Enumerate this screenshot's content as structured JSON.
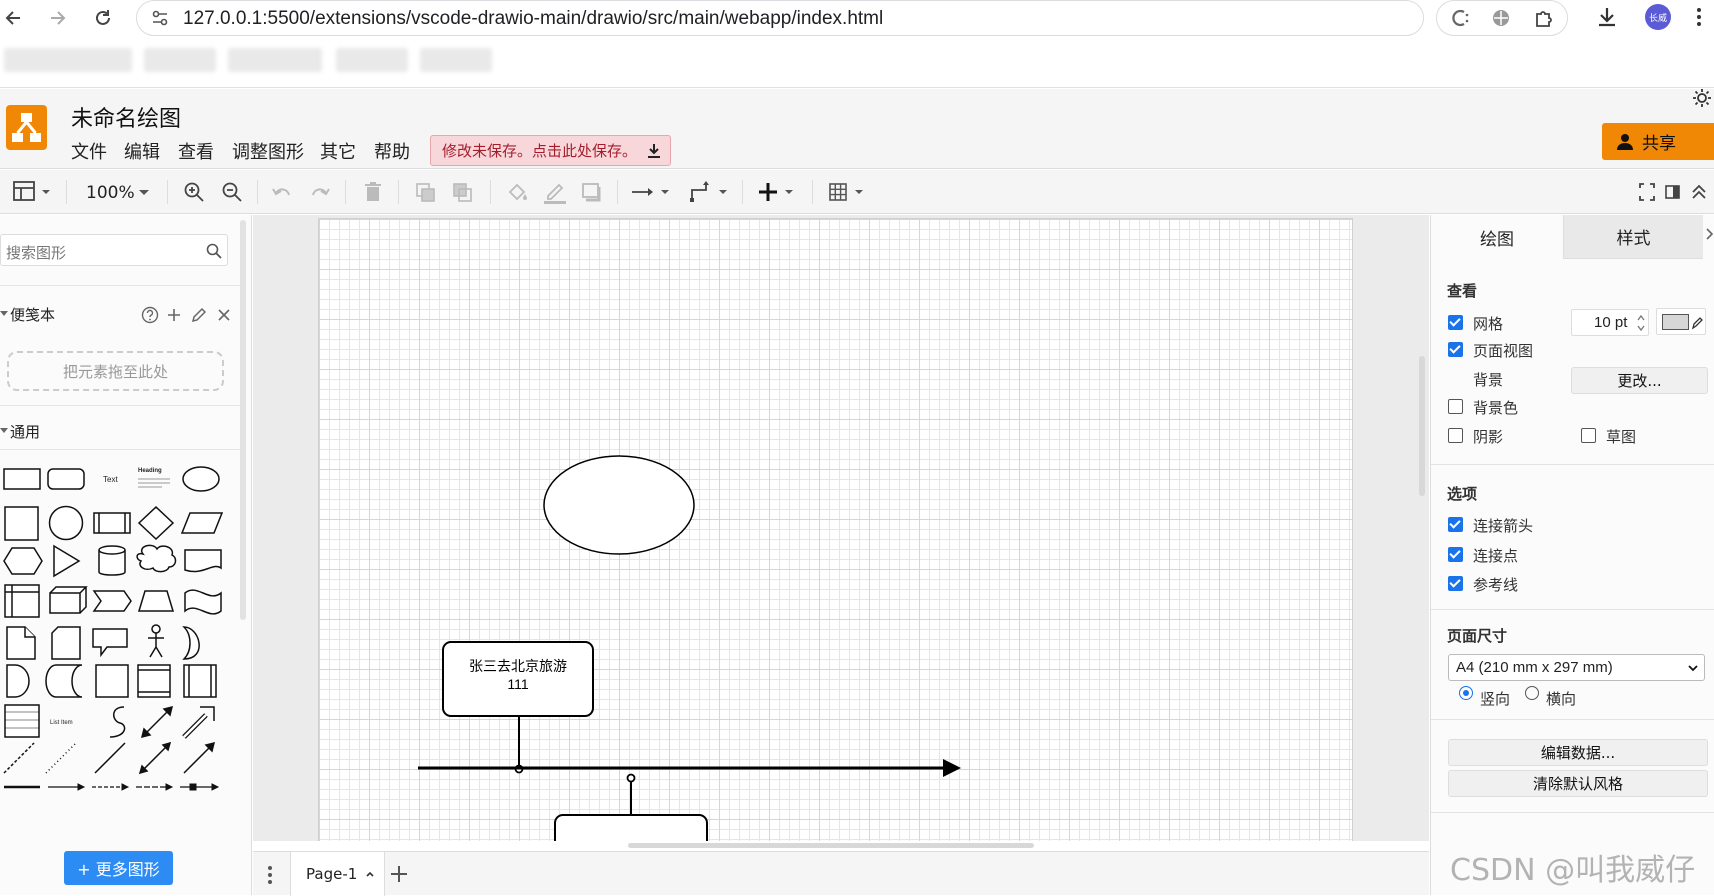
{
  "browser": {
    "url": "127.0.0.1:5500/extensions/vscode-drawio-main/drawio/src/main/webapp/index.html",
    "avatar_label": "长威"
  },
  "app": {
    "title": "未命名绘图",
    "menu": [
      "文件",
      "编辑",
      "查看",
      "调整图形",
      "其它",
      "帮助"
    ],
    "unsaved_notice": "修改未保存。点击此处保存。",
    "share_label": "共享"
  },
  "toolbar": {
    "zoom": "100%"
  },
  "left_panel": {
    "search_placeholder": "搜索图形",
    "scratchpad_title": "便笺本",
    "drop_hint": "把元素拖至此处",
    "general_title": "通用",
    "shape_labels": {
      "text": "Text",
      "heading": "Heading",
      "list_item": "List Item"
    },
    "more_shapes": "+ 更多图形"
  },
  "diagram": {
    "box1_line1": "张三去北京旅游",
    "box1_line2": "111"
  },
  "pages": {
    "current": "Page-1"
  },
  "right_panel": {
    "tabs": [
      "绘图",
      "样式"
    ],
    "view_section": "查看",
    "grid_label": "网格",
    "grid_checked": true,
    "grid_size": "10 pt",
    "page_view_label": "页面视图",
    "page_view_checked": true,
    "background_label": "背景",
    "change_button": "更改...",
    "bg_color_label": "背景色",
    "bg_color_checked": false,
    "shadow_label": "阴影",
    "shadow_checked": false,
    "sketch_label": "草图",
    "sketch_checked": false,
    "options_section": "选项",
    "connection_arrows": "连接箭头",
    "connection_points": "连接点",
    "guides": "参考线",
    "page_size_section": "页面尺寸",
    "page_size_value": "A4 (210 mm x 297 mm)",
    "portrait": "竖向",
    "landscape": "横向",
    "orientation": "portrait",
    "edit_data_button": "编辑数据...",
    "clear_style_button": "清除默认风格"
  },
  "watermark": "CSDN @叫我威仔",
  "colors": {
    "accent": "#f08705",
    "primary_blue": "#2c8cf4",
    "check_blue": "#1a73e8",
    "unsaved_bg": "#f8d7da"
  }
}
